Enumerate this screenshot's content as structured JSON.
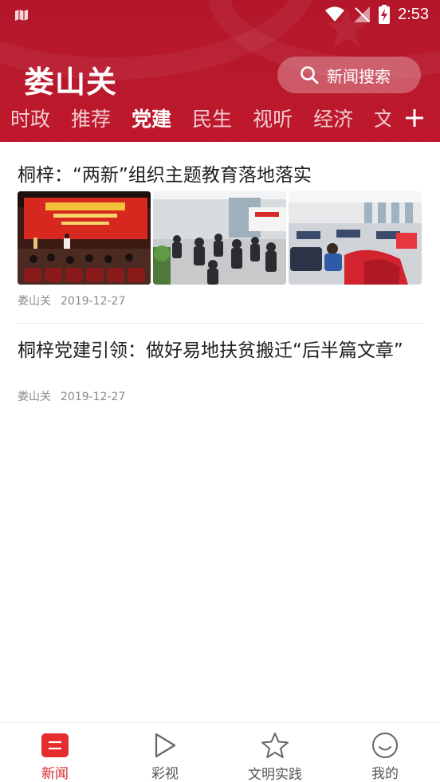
{
  "status_bar": {
    "time": "2:53"
  },
  "header": {
    "app_title": "娄山关",
    "search_label": "新闻搜索",
    "tabs": [
      {
        "label": "时政",
        "active": false
      },
      {
        "label": "推荐",
        "active": false
      },
      {
        "label": "党建",
        "active": true
      },
      {
        "label": "民生",
        "active": false
      },
      {
        "label": "视听",
        "active": false
      },
      {
        "label": "经济",
        "active": false
      },
      {
        "label": "文",
        "active": false
      }
    ]
  },
  "articles": [
    {
      "title": "桐梓：“两新”组织主题教育落地落实",
      "source": "娄山关",
      "date": "2019-12-27",
      "images": [
        "meeting-stage-photo",
        "seated-audience-photo",
        "garment-workshop-photo"
      ]
    },
    {
      "title": "桐梓党建引领：做好易地扶贫搬迁“后半篇文章”",
      "source": "娄山关",
      "date": "2019-12-27"
    }
  ],
  "bottom_nav": [
    {
      "label": "新闻",
      "icon": "news-icon",
      "active": true
    },
    {
      "label": "彩视",
      "icon": "play-icon",
      "active": false
    },
    {
      "label": "文明实践",
      "icon": "star-icon",
      "active": false
    },
    {
      "label": "我的",
      "icon": "smile-icon",
      "active": false
    }
  ],
  "colors": {
    "brand_red": "#b9192d",
    "active_nav": "#d8262f"
  }
}
